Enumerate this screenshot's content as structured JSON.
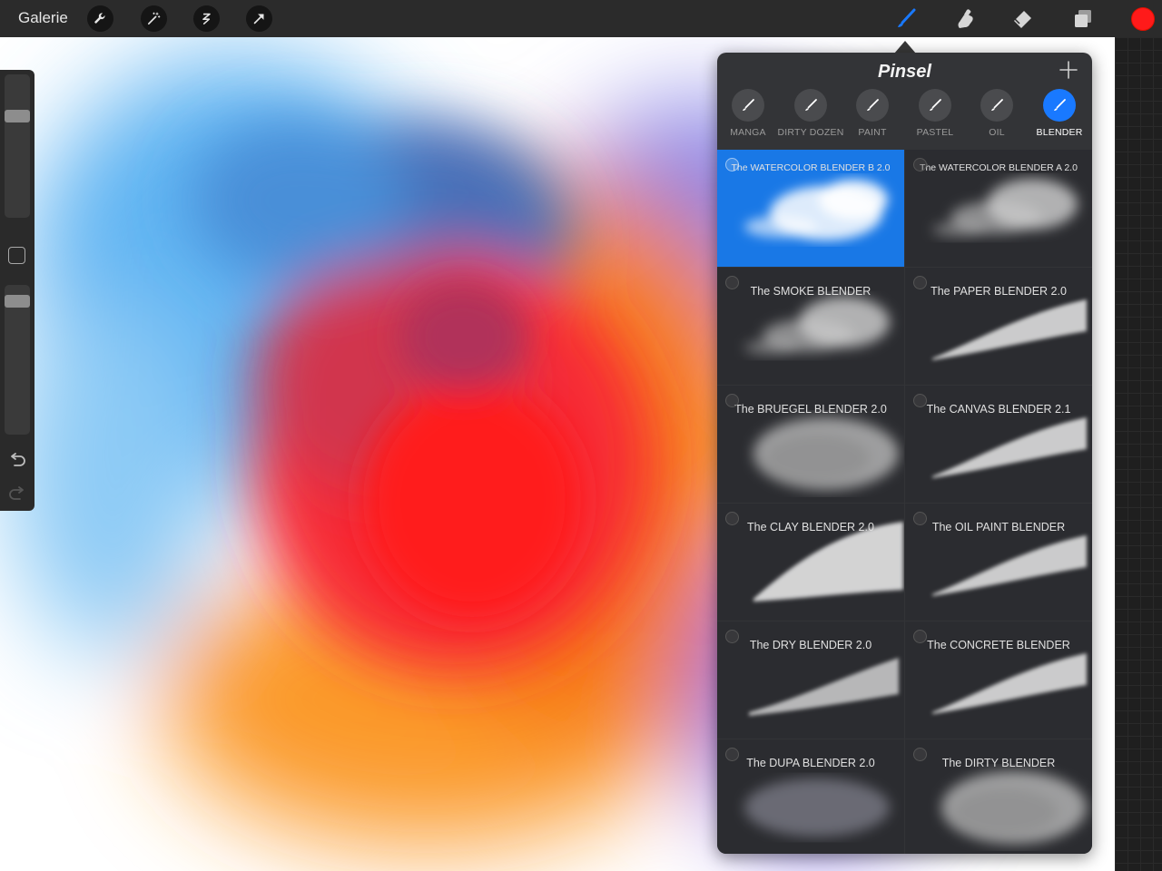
{
  "toolbar": {
    "gallery_label": "Galerie",
    "left_tools": [
      "wrench-icon",
      "magic-wand-icon",
      "selection-icon",
      "transform-arrow-icon"
    ],
    "right_tools": [
      "brush-icon",
      "smudge-icon",
      "eraser-icon",
      "layers-icon"
    ],
    "active_tool": "brush-icon",
    "current_color": "#ff1a1a"
  },
  "sidebar": {
    "brush_size_level": 0.73,
    "opacity_level": 0.93,
    "icons": [
      "modify-square-icon",
      "undo-icon",
      "redo-icon"
    ]
  },
  "brush_panel": {
    "title": "Pinsel",
    "add_icon": "plus-icon",
    "categories": [
      {
        "label": "MANGA"
      },
      {
        "label": "DIRTY DOZEN"
      },
      {
        "label": "PAINT"
      },
      {
        "label": "PASTEL"
      },
      {
        "label": "OIL"
      },
      {
        "label": "BLENDER"
      }
    ],
    "active_category": "BLENDER",
    "brushes": [
      {
        "name": "The WATERCOLOR BLENDER B 2.0"
      },
      {
        "name": "The WATERCOLOR BLENDER A 2.0"
      },
      {
        "name": "The SMOKE BLENDER"
      },
      {
        "name": "The PAPER BLENDER 2.0"
      },
      {
        "name": "The BRUEGEL BLENDER 2.0"
      },
      {
        "name": "The CANVAS BLENDER 2.1"
      },
      {
        "name": "The CLAY BLENDER 2.0"
      },
      {
        "name": "The OIL PAINT BLENDER"
      },
      {
        "name": "The DRY BLENDER 2.0"
      },
      {
        "name": "The CONCRETE BLENDER"
      },
      {
        "name": "The DUPA BLENDER 2.0"
      },
      {
        "name": "The DIRTY BLENDER"
      }
    ],
    "selected_brush": "The WATERCOLOR BLENDER B 2.0"
  },
  "colors": {
    "accent": "#1979ff",
    "panel_bg": "#333437"
  }
}
